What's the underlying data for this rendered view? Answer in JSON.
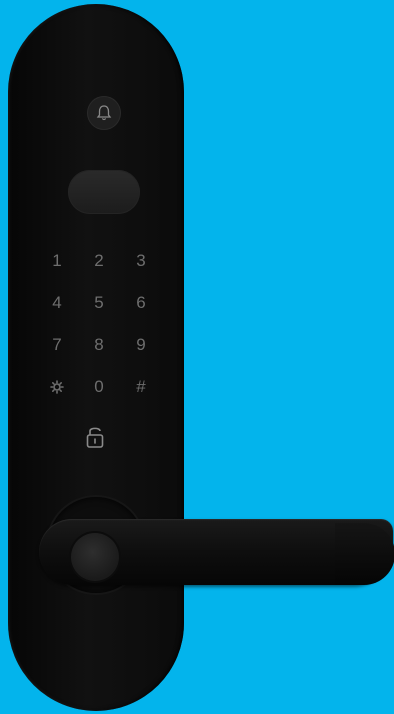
{
  "scene": {
    "background_color": "#03b4ec",
    "lock_color": "#0e0e0e"
  },
  "icons": {
    "doorbell": "bell-icon",
    "unlock": "padlock-icon",
    "star_key": "gear-icon"
  },
  "keypad": {
    "row1": [
      "1",
      "2",
      "3"
    ],
    "row2": [
      "4",
      "5",
      "6"
    ],
    "row3": [
      "7",
      "8",
      "9"
    ],
    "row4": [
      "",
      "0",
      "#"
    ]
  }
}
